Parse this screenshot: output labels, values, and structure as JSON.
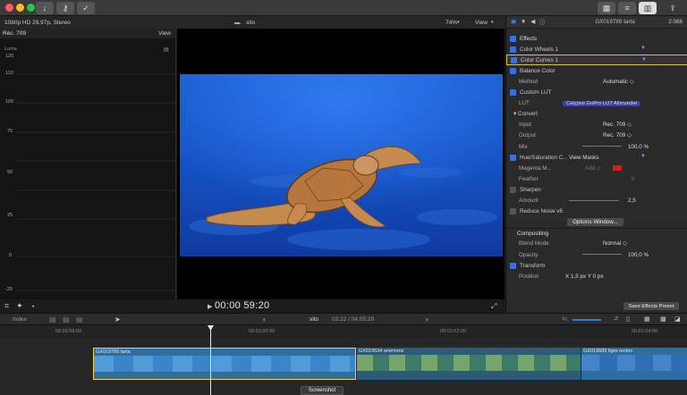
{
  "titlebar": {
    "icons": [
      "download-icon",
      "key-icon",
      "checkmark-icon"
    ],
    "right_icons": [
      "grid-icon",
      "sliders-icon",
      "inspector-icon",
      "share-icon"
    ]
  },
  "viewer": {
    "format": "1080p HD 29.97p, Stereo",
    "project": "sito",
    "zoom": "74%",
    "view_label": "View"
  },
  "scope": {
    "title": "Rec. 709",
    "view_label": "View",
    "label": "Luma",
    "ticks": [
      "120",
      "110",
      "100",
      "75",
      "50",
      "25",
      "0",
      "-20"
    ]
  },
  "inspector": {
    "clip_name": "GX019789 tarta",
    "duration": "2:088",
    "rows": [
      {
        "label": "Effects",
        "kind": "header"
      },
      {
        "label": "Color Wheels 1",
        "kind": "check"
      },
      {
        "label": "Color Curves 1",
        "kind": "check",
        "selected": true
      },
      {
        "label": "Balance Color",
        "kind": "check"
      },
      {
        "label": "Method",
        "kind": "param",
        "value": "Automatic ◇"
      },
      {
        "label": "Custom LUT",
        "kind": "check"
      },
      {
        "label": "LUT",
        "kind": "param",
        "value": "Calypso GoPro LUT Allrounder"
      },
      {
        "label": "▾ Convert",
        "kind": "sub"
      },
      {
        "label": "Input",
        "kind": "param",
        "value": "Rec. 709 ◇"
      },
      {
        "label": "Output",
        "kind": "param",
        "value": "Rec. 709 ◇"
      },
      {
        "label": "Mix",
        "kind": "param",
        "value": "100,0 %"
      },
      {
        "label": "Hue/Saturation C...",
        "kind": "check",
        "value": "View Masks"
      },
      {
        "label": "Magenta M...",
        "kind": "param",
        "value": "Add ◇"
      },
      {
        "label": "Feather",
        "kind": "param",
        "value": "0"
      },
      {
        "label": "Sharpen",
        "kind": "checkoff"
      },
      {
        "label": "Amount",
        "kind": "param",
        "value": "2,5"
      },
      {
        "label": "Reduce Noise v6",
        "kind": "checkoff"
      },
      {
        "label": "Options Window...",
        "kind": "button"
      },
      {
        "label": "Compositing",
        "kind": "section"
      },
      {
        "label": "Blend Mode",
        "kind": "param",
        "value": "Normal ◇"
      },
      {
        "label": "Opacity",
        "kind": "param",
        "value": "100,0 %"
      },
      {
        "label": "Transform",
        "kind": "check"
      },
      {
        "label": "Position",
        "kind": "param",
        "value": "X   1,5 px    Y   0 px"
      }
    ],
    "save_preset": "Save Effects Preset"
  },
  "transport": {
    "timecode": "00:00 59:20"
  },
  "timeline": {
    "index": "Index",
    "project": "sito",
    "position": "03:22 / 04:05:29",
    "ruler": [
      "00:00:58:00",
      "00:01:00:00",
      "00:01:02:00",
      "00:01:04:00"
    ],
    "clips": [
      {
        "name": "GX019789 tarta",
        "color": "#2f6d9e"
      },
      {
        "name": "GX019534 anemonz",
        "color": "#2c5b7a"
      },
      {
        "name": "GX019689 tigre rectos",
        "color": "#2f6d9e"
      }
    ],
    "tooltip": "Screenshot"
  },
  "colors": {
    "accent": "#3b6fe0",
    "clip_selected": "#f5d442"
  }
}
